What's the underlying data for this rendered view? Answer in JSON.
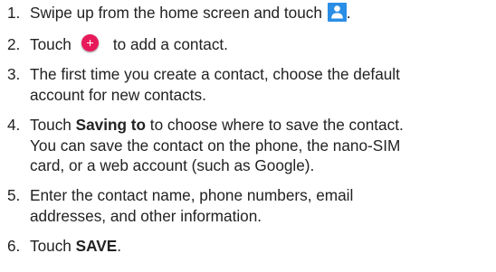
{
  "steps": [
    {
      "number": "1.",
      "lines": [
        "Swipe up from the home screen and touch",
        "."
      ]
    },
    {
      "number": "2.",
      "lines": [
        "Touch",
        "to add a contact."
      ]
    },
    {
      "number": "3.",
      "lines": [
        "The first time you create a contact, choose the default",
        "account for new contacts."
      ]
    },
    {
      "number": "4.",
      "bold": "Saving to",
      "lines": [
        "Touch",
        "to choose where to save the contact.",
        "You can save the contact on the phone, the nano-SIM",
        "card, or a web account (such as Google)."
      ]
    },
    {
      "number": "5.",
      "lines": [
        "Enter the contact name, phone numbers, email",
        "addresses, and other information."
      ]
    },
    {
      "number": "6.",
      "bold": "SAVE",
      "lines": [
        "Touch",
        "."
      ]
    }
  ],
  "icons": {
    "contacts": "contacts-app-icon",
    "add": "add-contact-button-icon"
  },
  "colors": {
    "contacts_icon": "#2a8ee6",
    "add_button": "#e8195a",
    "text": "#222222"
  }
}
